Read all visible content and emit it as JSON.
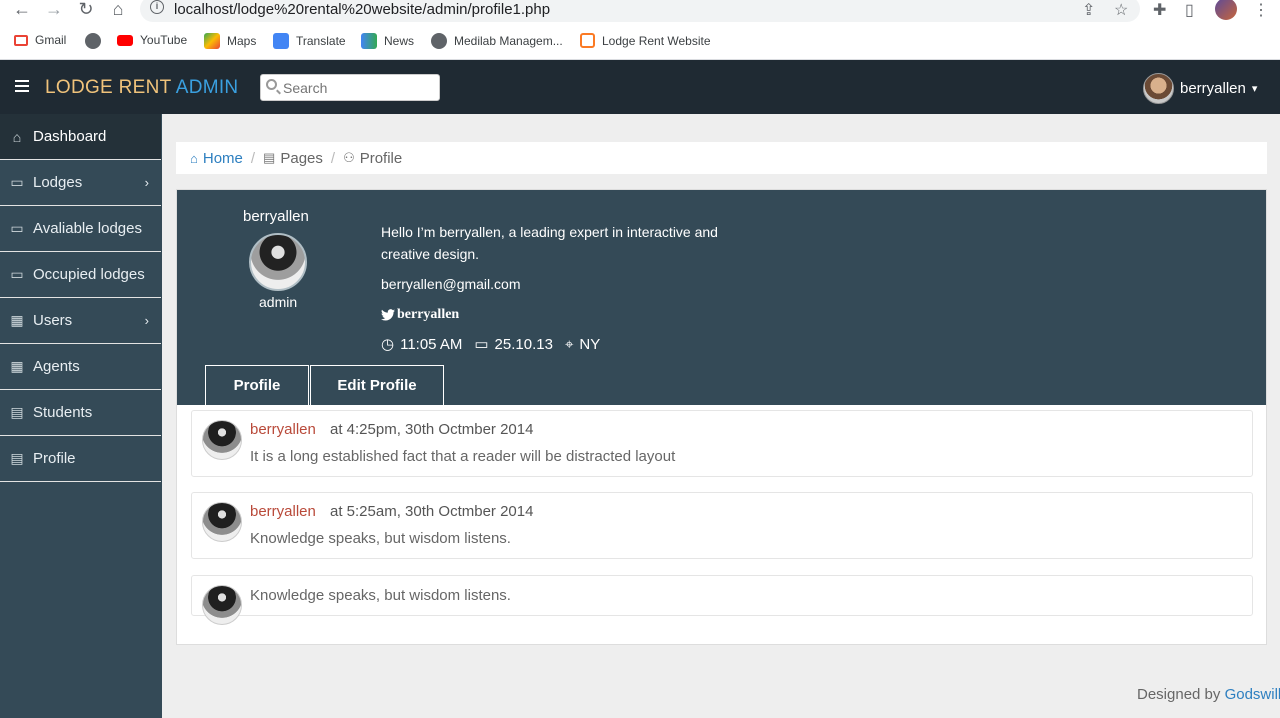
{
  "browser": {
    "url": "localhost/lodge%20rental%20website/admin/profile1.php",
    "bookmarks": [
      {
        "label": "Gmail",
        "icon": "gmail-icon",
        "color": "#ea4335"
      },
      {
        "label": "",
        "icon": "globe-icon",
        "color": "#5f6368"
      },
      {
        "label": "YouTube",
        "icon": "youtube-icon",
        "color": "#ff0000"
      },
      {
        "label": "Maps",
        "icon": "maps-icon",
        "color": "#34a853"
      },
      {
        "label": "Translate",
        "icon": "translate-icon",
        "color": "#4285f4"
      },
      {
        "label": "News",
        "icon": "news-icon",
        "color": "#4285f4"
      },
      {
        "label": "Medilab Managem...",
        "icon": "globe-icon",
        "color": "#5f6368"
      },
      {
        "label": "Lodge Rent Website",
        "icon": "xampp-icon",
        "color": "#fb7a24"
      }
    ]
  },
  "header": {
    "brand_primary": "LODGE RENT",
    "brand_secondary": "ADMIN",
    "search_placeholder": "Search",
    "username": "berryallen",
    "caret": "▾"
  },
  "sidebar": {
    "items": [
      {
        "label": "Dashboard",
        "icon": "home-icon",
        "active": true
      },
      {
        "label": "Lodges",
        "icon": "monitor-icon",
        "chevron": "›"
      },
      {
        "label": "Avaliable lodges",
        "icon": "monitor-icon"
      },
      {
        "label": "Occupied lodges",
        "icon": "monitor-icon"
      },
      {
        "label": "Users",
        "icon": "table-icon",
        "chevron": "›"
      },
      {
        "label": "Agents",
        "icon": "table-icon"
      },
      {
        "label": "Students",
        "icon": "list-icon"
      },
      {
        "label": "Profile",
        "icon": "list-icon"
      }
    ]
  },
  "breadcrumb": {
    "home": "Home",
    "pages": "Pages",
    "current": "Profile",
    "separator": "/"
  },
  "profile": {
    "name": "berryallen",
    "role": "admin",
    "bio": "Hello I’m berryallen, a leading expert in interactive and creative design.",
    "email": "berryallen@gmail.com",
    "twitter": "berryallen",
    "time": "11:05 AM",
    "date": "25.10.13",
    "location": "NY",
    "tabs": [
      "Profile",
      "Edit Profile"
    ]
  },
  "comments": [
    {
      "author": "berryallen",
      "time": "at 4:25pm, 30th Octmber 2014",
      "text": "It is a long established fact that a reader will be distracted layout"
    },
    {
      "author": "berryallen",
      "time": "at 5:25am, 30th Octmber 2014",
      "text": "Knowledge speaks, but wisdom listens."
    },
    {
      "author": "",
      "time": "",
      "text": "Knowledge speaks, but wisdom listens."
    }
  ],
  "footer": {
    "prefix": "Designed by",
    "link": "Godswill"
  }
}
